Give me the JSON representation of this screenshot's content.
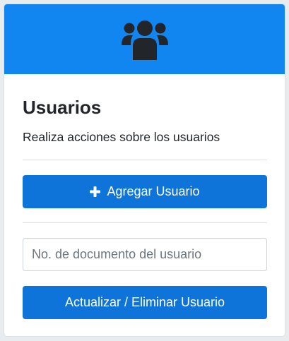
{
  "header": {
    "icon": "users-icon",
    "background_color": "#1185f0",
    "icon_color": "#222529"
  },
  "card": {
    "title": "Usuarios",
    "subtitle": "Realiza acciones sobre los usuarios"
  },
  "add_button": {
    "icon": "plus-icon",
    "label": "Agregar Usuario",
    "color": "#0f74da"
  },
  "document_input": {
    "value": "",
    "placeholder": "No. de documento del usuario"
  },
  "update_button": {
    "label": "Actualizar / Eliminar Usuario",
    "color": "#0f74da"
  }
}
